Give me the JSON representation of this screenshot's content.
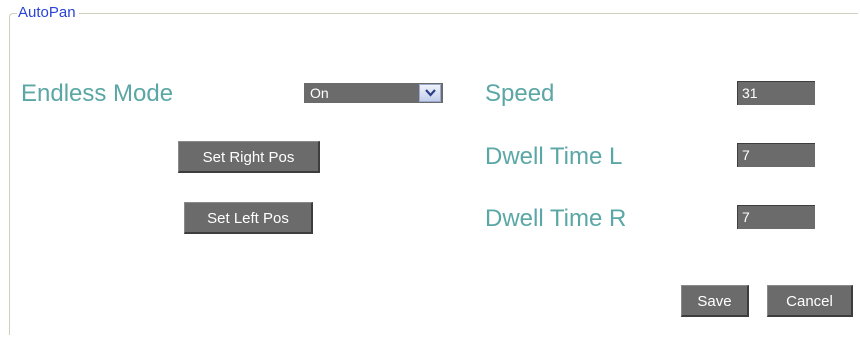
{
  "group": {
    "title": "AutoPan"
  },
  "endless_mode": {
    "label": "Endless Mode",
    "selected": "On",
    "dropdown_icon": "chevron-down-icon"
  },
  "speed": {
    "label": "Speed",
    "value": "31"
  },
  "dwell_time_l": {
    "label": "Dwell Time L",
    "value": "7"
  },
  "dwell_time_r": {
    "label": "Dwell Time R",
    "value": "7"
  },
  "buttons": {
    "set_right_pos": "Set Right Pos",
    "set_left_pos": "Set Left Pos",
    "save": "Save",
    "cancel": "Cancel"
  },
  "colors": {
    "label": "#5aa7a5",
    "legend": "#2a44d4",
    "control_bg": "#6b6b6b"
  }
}
